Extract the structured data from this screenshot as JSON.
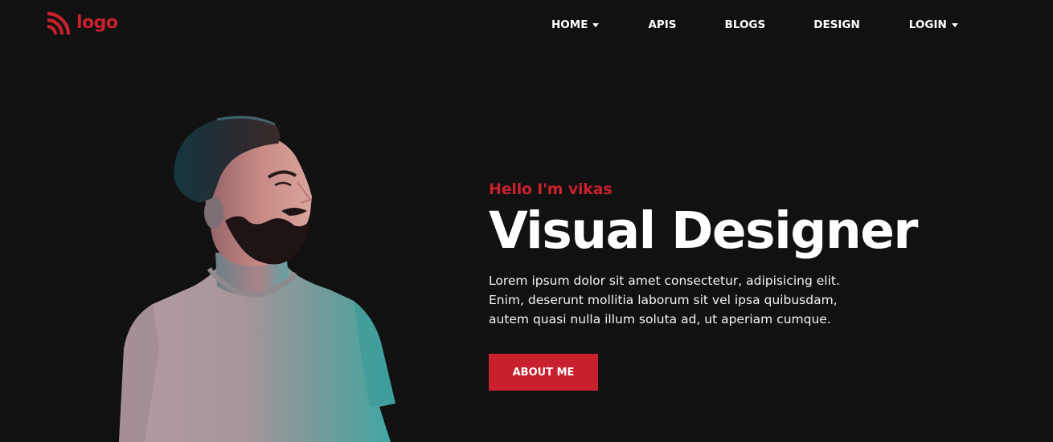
{
  "colors": {
    "background": "#111112",
    "accent": "#c8202d",
    "text": "#ffffff"
  },
  "header": {
    "logo_icon": "wifi-signal-icon",
    "logo_text": "logo",
    "nav": [
      {
        "label": "HOME",
        "has_dropdown": true
      },
      {
        "label": "APIS",
        "has_dropdown": false
      },
      {
        "label": "BLOGS",
        "has_dropdown": false
      },
      {
        "label": "DESIGN",
        "has_dropdown": false
      },
      {
        "label": "LOGIN",
        "has_dropdown": true
      }
    ]
  },
  "hero": {
    "greeting": "Hello I'm vikas",
    "title": "Visual Designer",
    "description": "Lorem ipsum dolor sit amet consectetur, adipisicing elit. Enim, deserunt mollitia laborum sit vel ipsa quibusdam, autem quasi nulla illum soluta ad, ut aperiam cumque.",
    "button_label": "ABOUT ME",
    "image": "bearded-man-portrait"
  }
}
